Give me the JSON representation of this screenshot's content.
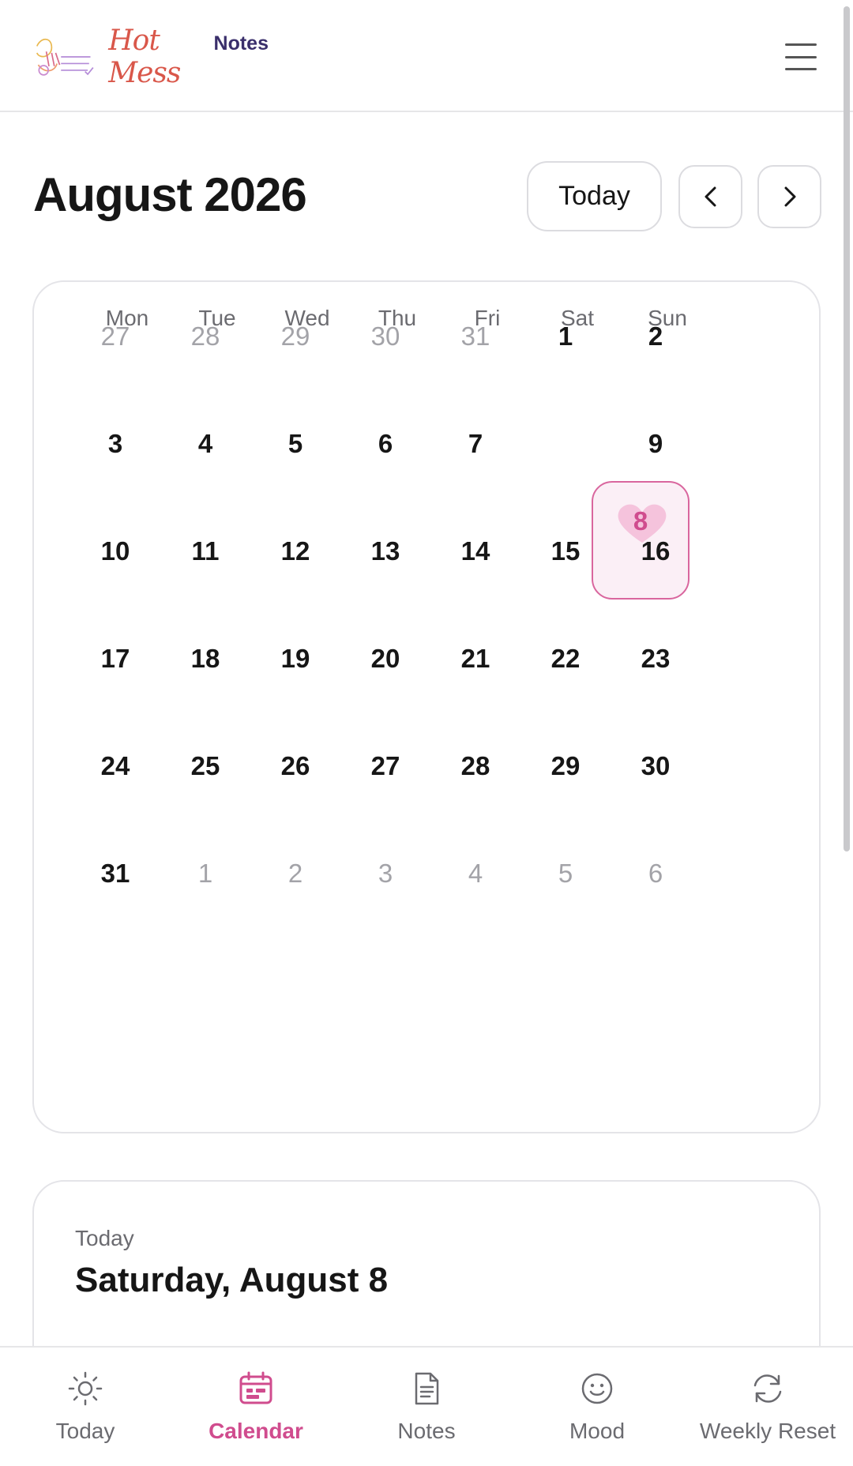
{
  "app": {
    "logo_main": "Hot Mess",
    "logo_sub": "Notes"
  },
  "toolbar": {
    "month_title": "August 2026",
    "today_label": "Today",
    "prev_icon": "chevron-left-icon",
    "next_icon": "chevron-right-icon"
  },
  "calendar": {
    "weekdays": [
      "Mon",
      "Tue",
      "Wed",
      "Thu",
      "Fri",
      "Sat",
      "Sun"
    ],
    "weeks": [
      [
        {
          "d": "27",
          "m": true
        },
        {
          "d": "28",
          "m": true
        },
        {
          "d": "29",
          "m": true
        },
        {
          "d": "30",
          "m": true
        },
        {
          "d": "31",
          "m": true
        },
        {
          "d": "1",
          "m": false
        },
        {
          "d": "2",
          "m": false
        }
      ],
      [
        {
          "d": "3",
          "m": false
        },
        {
          "d": "4",
          "m": false
        },
        {
          "d": "5",
          "m": false
        },
        {
          "d": "6",
          "m": false
        },
        {
          "d": "7",
          "m": false
        },
        {
          "d": "8",
          "m": false
        },
        {
          "d": "9",
          "m": false
        }
      ],
      [
        {
          "d": "10",
          "m": false
        },
        {
          "d": "11",
          "m": false
        },
        {
          "d": "12",
          "m": false
        },
        {
          "d": "13",
          "m": false
        },
        {
          "d": "14",
          "m": false
        },
        {
          "d": "15",
          "m": false
        },
        {
          "d": "16",
          "m": false
        }
      ],
      [
        {
          "d": "17",
          "m": false
        },
        {
          "d": "18",
          "m": false
        },
        {
          "d": "19",
          "m": false
        },
        {
          "d": "20",
          "m": false
        },
        {
          "d": "21",
          "m": false
        },
        {
          "d": "22",
          "m": false
        },
        {
          "d": "23",
          "m": false
        }
      ],
      [
        {
          "d": "24",
          "m": false
        },
        {
          "d": "25",
          "m": false
        },
        {
          "d": "26",
          "m": false
        },
        {
          "d": "27",
          "m": false
        },
        {
          "d": "28",
          "m": false
        },
        {
          "d": "29",
          "m": false
        },
        {
          "d": "30",
          "m": false
        }
      ],
      [
        {
          "d": "31",
          "m": false
        },
        {
          "d": "1",
          "m": true
        },
        {
          "d": "2",
          "m": true
        },
        {
          "d": "3",
          "m": true
        },
        {
          "d": "4",
          "m": true
        },
        {
          "d": "5",
          "m": true
        },
        {
          "d": "6",
          "m": true
        }
      ]
    ],
    "selected_day": "8",
    "selected_icon": "heart-icon",
    "accent_color": "#d04c8e"
  },
  "today_card": {
    "label": "Today",
    "date": "Saturday, August 8"
  },
  "nav": {
    "items": [
      {
        "label": "Today",
        "icon": "sun-icon",
        "active": false
      },
      {
        "label": "Calendar",
        "icon": "calendar-icon",
        "active": true
      },
      {
        "label": "Notes",
        "icon": "document-icon",
        "active": false
      },
      {
        "label": "Mood",
        "icon": "smiley-icon",
        "active": false
      },
      {
        "label": "Weekly Reset",
        "icon": "refresh-icon",
        "active": false
      }
    ]
  }
}
